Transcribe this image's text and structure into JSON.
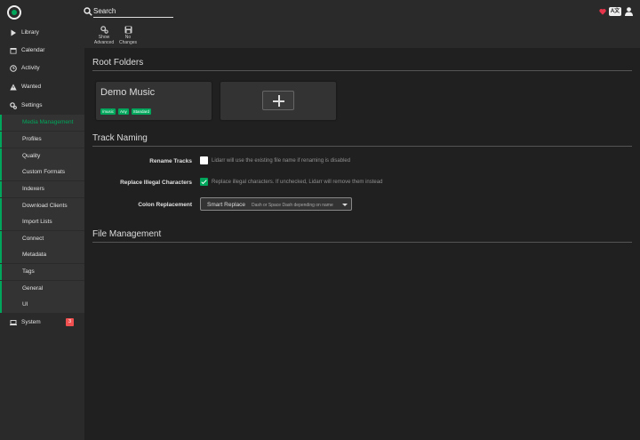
{
  "header": {
    "search_placeholder": "Search",
    "lang_label": "A文"
  },
  "sidebar": {
    "items": [
      {
        "label": "Library",
        "icon": "play-icon"
      },
      {
        "label": "Calendar",
        "icon": "calendar-icon"
      },
      {
        "label": "Activity",
        "icon": "clock-icon"
      },
      {
        "label": "Wanted",
        "icon": "warning-icon"
      },
      {
        "label": "Settings",
        "icon": "gear-icon"
      }
    ],
    "settings_sub": [
      "Media Management",
      "Profiles",
      "Quality",
      "Custom Formats",
      "Indexers",
      "Download Clients",
      "Import Lists",
      "Connect",
      "Metadata",
      "Tags",
      "General",
      "UI"
    ],
    "active_sub": "Media Management",
    "system": {
      "label": "System",
      "badge": "3"
    }
  },
  "toolbar": {
    "show_advanced": [
      "Show",
      "Advanced"
    ],
    "no_changes": [
      "No",
      "Changes"
    ]
  },
  "main": {
    "root_folders": {
      "title": "Root Folders",
      "card": {
        "name": "Demo Music",
        "tags": [
          "/music",
          "Any",
          "Standard"
        ]
      }
    },
    "track_naming": {
      "title": "Track Naming",
      "rename_label": "Rename Tracks",
      "rename_checked": false,
      "rename_help": "Lidarr will use the existing file name if renaming is disabled",
      "illegal_label": "Replace Illegal Characters",
      "illegal_checked": true,
      "illegal_help": "Replace illegal characters. If unchecked, Lidarr will remove them instead",
      "colon_label": "Colon Replacement",
      "colon_value": "Smart Replace",
      "colon_hint": "Dash or Space Dash depending on name"
    },
    "file_management": {
      "title": "File Management"
    }
  },
  "colors": {
    "accent": "#00a65b",
    "badge": "#f05050",
    "heart": "#e6344b"
  }
}
